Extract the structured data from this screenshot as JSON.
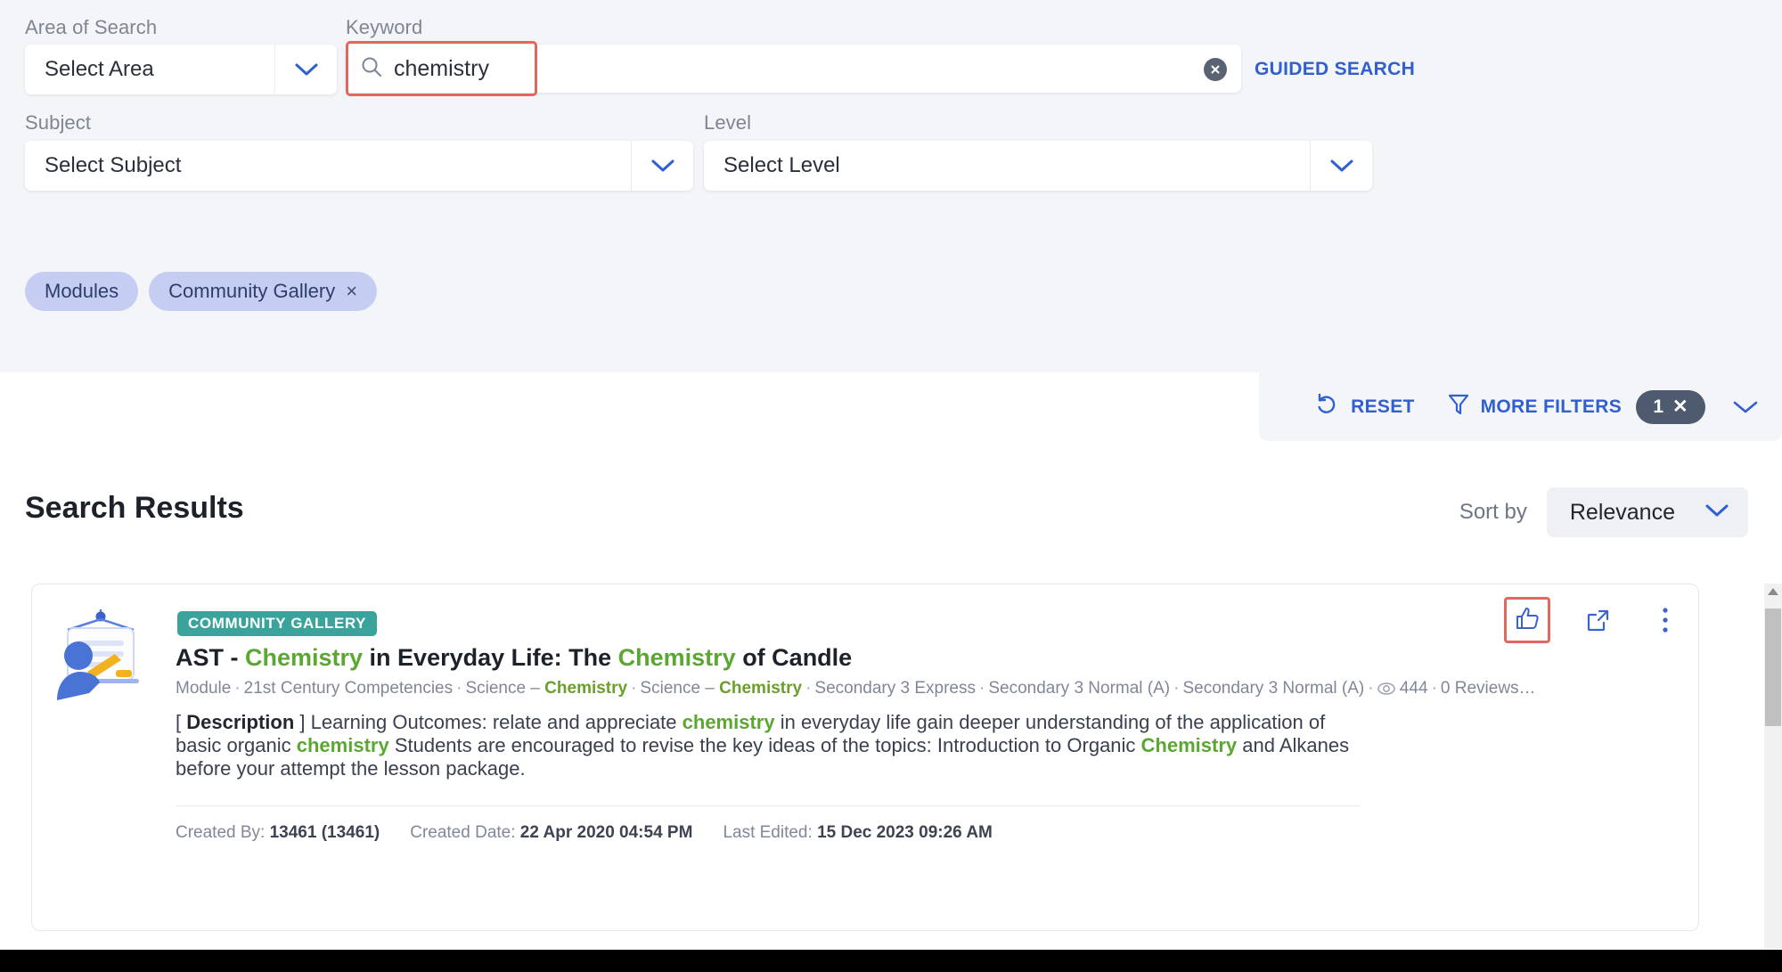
{
  "filters": {
    "area_label": "Area of Search",
    "area_value": "Select Area",
    "keyword_label": "Keyword",
    "keyword_value": "chemistry",
    "keyword_placeholder": "Keyword",
    "guided_search": "GUIDED SEARCH",
    "subject_label": "Subject",
    "subject_value": "Select Subject",
    "level_label": "Level",
    "level_value": "Select Level",
    "chips": [
      {
        "label": "Modules",
        "removable": false,
        "x": ""
      },
      {
        "label": "Community Gallery",
        "removable": true,
        "x": "×"
      }
    ],
    "reset_label": "RESET",
    "more_filters_label": "MORE FILTERS",
    "filter_count": "1",
    "filter_count_clear": "✕",
    "icons": {
      "search": "search-icon",
      "clear": "clear-circle-icon",
      "reset": "undo-icon",
      "funnel": "funnel-icon",
      "chevron": "chevron-down-icon"
    },
    "colors": {
      "panel_bg": "#f4f5f8",
      "accent_blue": "#2f5fd0",
      "chip_bg": "#c5cef2",
      "chip_text": "#2e3d6b",
      "badge_dark": "#4e5b6e",
      "focus_ring_red": "#e2685f"
    }
  },
  "results": {
    "heading": "Search Results",
    "sort_label": "Sort by",
    "sort_value": "Relevance",
    "sort_options": [
      "Relevance"
    ],
    "cards": [
      {
        "badge": "COMMUNITY GALLERY",
        "badge_color": "#3aa39c",
        "thumbnail": "teacher-whiteboard-illustration",
        "title_parts": [
          {
            "text": "AST - ",
            "highlight": false
          },
          {
            "text": "Chemistry",
            "highlight": true
          },
          {
            "text": " in Everyday Life: The ",
            "highlight": false
          },
          {
            "text": "Chemistry",
            "highlight": true
          },
          {
            "text": " of Candle",
            "highlight": false
          }
        ],
        "title_plain": "AST - Chemistry in Everyday Life: The Chemistry of Candle",
        "meta": [
          {
            "text": "Module",
            "bold": false
          },
          {
            "text": "21st Century Competencies",
            "bold": false
          },
          {
            "text": "Science – Chemistry",
            "bold": false,
            "bold_tail": "Chemistry"
          },
          {
            "text": "Science – Chemistry",
            "bold": false,
            "bold_tail": "Chemistry"
          },
          {
            "text": "Secondary 3 Express",
            "bold": false
          },
          {
            "text": "Secondary 3 Normal (A)",
            "bold": false
          },
          {
            "text": "Secondary 3 Normal (A)",
            "bold": false
          }
        ],
        "views_icon": "eye-icon",
        "views": "444",
        "reviews": "0 Reviews",
        "meta_ellipsis": "…",
        "description_parts": [
          {
            "text": "[ ",
            "style": "plain"
          },
          {
            "text": "Description",
            "style": "bold"
          },
          {
            "text": " ] Learning Outcomes: relate and appreciate ",
            "style": "plain"
          },
          {
            "text": "chemistry",
            "style": "highlight"
          },
          {
            "text": " in everyday life gain deeper understanding of the application of basic organic ",
            "style": "plain"
          },
          {
            "text": "chemistry",
            "style": "highlight"
          },
          {
            "text": " Students are encouraged to revise the key ideas of the topics: Introduction to Organic ",
            "style": "plain"
          },
          {
            "text": "Chemistry",
            "style": "highlight"
          },
          {
            "text": " and Alkanes before your attempt the lesson package.",
            "style": "plain"
          }
        ],
        "footer": {
          "created_by_label": "Created By:",
          "created_by_value": "13461 (13461)",
          "created_date_label": "Created Date:",
          "created_date_value": "22 Apr 2020 04:54 PM",
          "last_edited_label": "Last Edited:",
          "last_edited_value": "15 Dec 2023 09:26 AM"
        },
        "actions": [
          {
            "name": "like-icon",
            "highlighted": true
          },
          {
            "name": "external-link-icon",
            "highlighted": false
          },
          {
            "name": "more-vertical-icon",
            "highlighted": false
          }
        ]
      }
    ]
  }
}
